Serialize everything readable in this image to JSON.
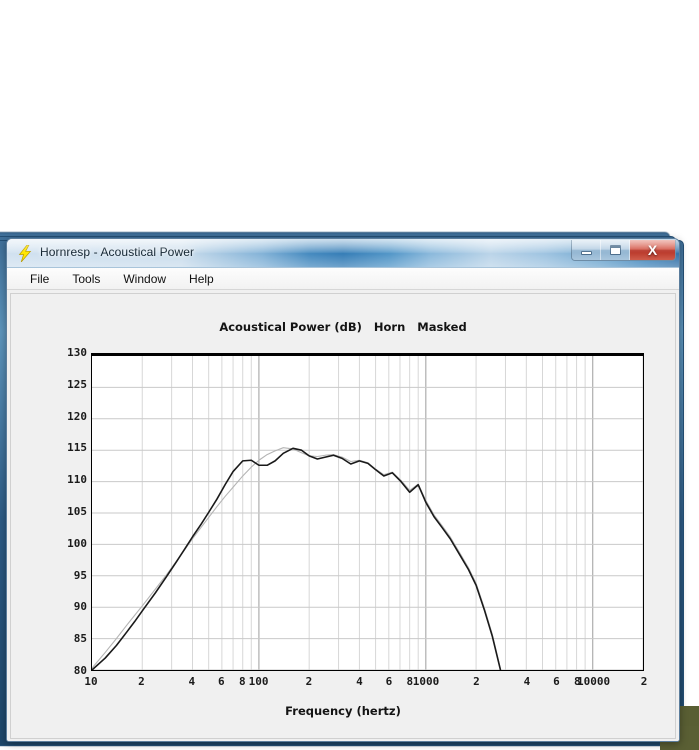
{
  "window": {
    "title": "Hornresp - Acoustical Power",
    "icon": "lightning-bolt-icon",
    "controls": {
      "minimize": "minimize-icon",
      "maximize": "maximize-icon",
      "close": "X"
    }
  },
  "menu": {
    "items": [
      {
        "label": "File"
      },
      {
        "label": "Tools"
      },
      {
        "label": "Window"
      },
      {
        "label": "Help"
      }
    ]
  },
  "chart_data": {
    "type": "line",
    "title": "Acoustical Power (dB)   Horn   Masked",
    "xlabel": "Frequency (hertz)",
    "ylabel": "",
    "xscale": "log",
    "xlim": [
      10,
      20000
    ],
    "ylim": [
      80,
      130
    ],
    "grid": true,
    "legend_position": "title",
    "ytick_labels": [
      "130",
      "125",
      "120",
      "115",
      "110",
      "105",
      "100",
      "95",
      "90",
      "85",
      "80"
    ],
    "ytick_values": [
      130,
      125,
      120,
      115,
      110,
      105,
      100,
      95,
      90,
      85,
      80
    ],
    "xtick_labels": [
      "10",
      "2",
      "4",
      "6",
      "8",
      "100",
      "2",
      "4",
      "6",
      "8",
      "1000",
      "2",
      "4",
      "6",
      "8",
      "10000",
      "2"
    ],
    "xtick_values": [
      10,
      20,
      40,
      60,
      80,
      100,
      200,
      400,
      600,
      800,
      1000,
      2000,
      4000,
      6000,
      8000,
      10000,
      20000
    ],
    "series": [
      {
        "name": "Horn",
        "color": "#b4b4b4",
        "x": [
          10,
          12,
          14,
          16,
          18,
          20,
          24,
          28,
          32,
          36,
          40,
          45,
          50,
          56,
          63,
          70,
          80,
          90,
          100,
          112,
          125,
          140,
          160,
          180,
          200,
          224,
          250,
          280,
          315,
          355,
          400,
          450,
          500,
          560,
          630,
          710,
          800,
          900,
          1000,
          1120,
          1250,
          1400,
          1600,
          1800,
          2000,
          2240,
          2500,
          2800
        ],
        "y": [
          80.3,
          82.8,
          85.0,
          87.0,
          88.7,
          90.2,
          92.9,
          95.2,
          97.3,
          99.2,
          100.9,
          102.7,
          104.3,
          106.0,
          107.7,
          109.1,
          110.9,
          112.3,
          113.4,
          114.3,
          114.9,
          115.4,
          115.2,
          114.6,
          114.1,
          114.0,
          114.2,
          114.3,
          113.9,
          113.2,
          113.4,
          113.0,
          112.0,
          111.1,
          111.5,
          110.2,
          108.6,
          109.6,
          107.0,
          104.7,
          103.0,
          101.2,
          98.6,
          96.3,
          93.8,
          89.9,
          85.7,
          80.2
        ]
      },
      {
        "name": "Masked",
        "color": "#1a1a1a",
        "x": [
          10,
          12,
          14,
          16,
          18,
          20,
          24,
          28,
          32,
          36,
          40,
          45,
          50,
          56,
          63,
          70,
          80,
          90,
          100,
          112,
          125,
          140,
          160,
          180,
          200,
          224,
          250,
          280,
          315,
          355,
          400,
          450,
          500,
          560,
          630,
          710,
          800,
          900,
          1000,
          1120,
          1250,
          1400,
          1600,
          1800,
          2000,
          2240,
          2500,
          2800
        ],
        "y": [
          80.0,
          81.9,
          83.9,
          85.9,
          87.7,
          89.4,
          92.3,
          94.9,
          97.2,
          99.3,
          101.2,
          103.2,
          105.1,
          107.2,
          109.6,
          111.6,
          113.3,
          113.4,
          112.6,
          112.6,
          113.3,
          114.5,
          115.3,
          115.0,
          114.1,
          113.6,
          113.9,
          114.2,
          113.7,
          112.8,
          113.3,
          112.9,
          111.9,
          110.9,
          111.4,
          110.0,
          108.3,
          109.5,
          106.7,
          104.4,
          102.7,
          100.9,
          98.3,
          96.0,
          93.5,
          89.6,
          85.4,
          80.0
        ]
      }
    ]
  }
}
